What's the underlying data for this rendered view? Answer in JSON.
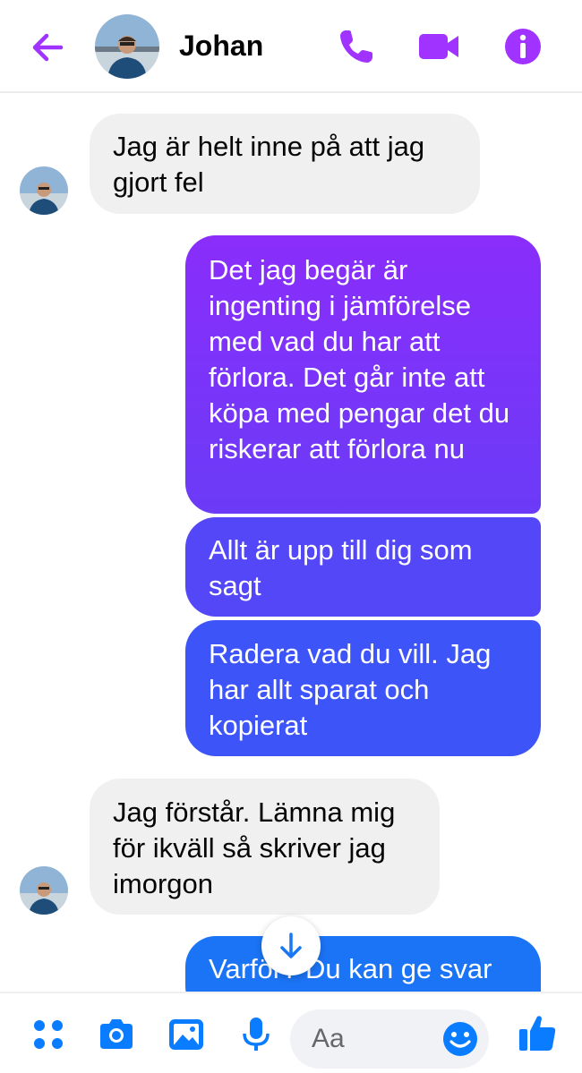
{
  "header": {
    "contact_name": "Johan",
    "accent_color": "#a033ff",
    "icons": [
      "back-arrow-icon",
      "phone-icon",
      "video-camera-icon",
      "info-icon"
    ]
  },
  "messages": [
    {
      "direction": "incoming",
      "text": "Jag är helt inne på att jag gjort fel"
    },
    {
      "direction": "outgoing",
      "text": "Det jag begär är ingenting i jämförelse med vad du har att förlora. Det går inte att köpa med pengar det du riskerar att förlora nu"
    },
    {
      "direction": "outgoing",
      "text": "Allt är upp till dig som sagt"
    },
    {
      "direction": "outgoing",
      "text": "Radera vad du vill. Jag har allt sparat och kopierat"
    },
    {
      "direction": "incoming",
      "text": "Jag förstår. Lämna mig för ikväll så skriver jag imorgon"
    },
    {
      "direction": "outgoing",
      "text": "Varför? Du kan ge svar"
    }
  ],
  "composer": {
    "placeholder": "Aa",
    "icons": [
      "apps-menu-icon",
      "camera-icon",
      "gallery-icon",
      "microphone-icon",
      "emoji-icon",
      "thumbs-up-icon"
    ],
    "icon_color": "#0a7cff"
  }
}
